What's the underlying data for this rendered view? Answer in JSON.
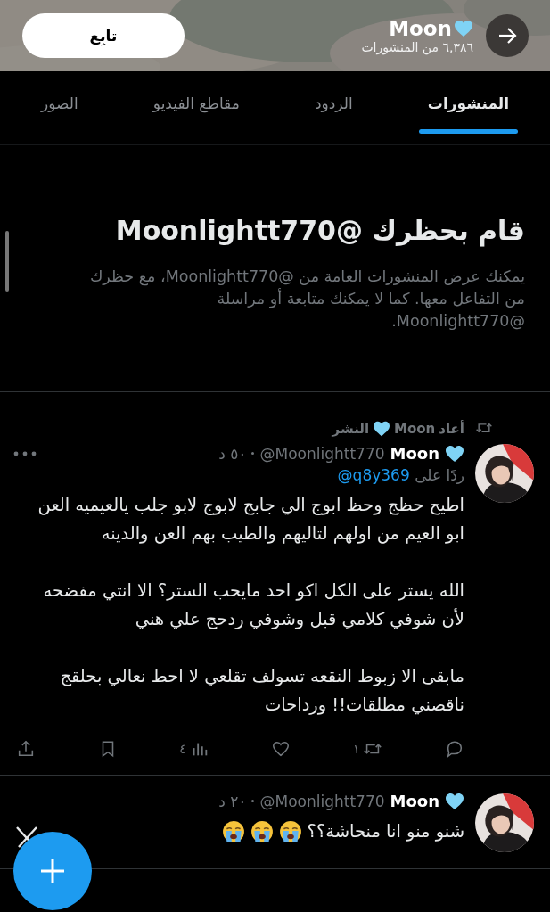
{
  "header": {
    "name": "Moon",
    "post_count": "٦,٣٨٦ من المنشورات",
    "follow_button": "تابِع"
  },
  "tabs": [
    {
      "label": "المنشورات",
      "selected": true
    },
    {
      "label": "الردود",
      "selected": false
    },
    {
      "label": "مقاطع الفيديو",
      "selected": false
    },
    {
      "label": "الصور",
      "selected": false
    }
  ],
  "blocked_notice": {
    "title": "قام بحظرك @Moonlightt770",
    "body": "يمكنك عرض المنشورات العامة من @Moonlightt770، مع حظرك من التفاعل معها. كما لا يمكنك متابعة أو مراسلة @Moonlightt770."
  },
  "posts": [
    {
      "repost_label": "أعاد",
      "repost_name": "Moon",
      "repost_suffix": "النشر",
      "name": "Moon",
      "handle": "@Moonlightt770",
      "time": "٥٠ د",
      "reply_prefix": "ردًا على",
      "reply_to": "@q8y369",
      "paragraphs": [
        "اطيح حظج وحظ ابوج الي جابج لابوج لابو جلب يالعيميه العن ابو العيم من اولهم لتاليهم والطيب بهم العن والدينه",
        "الله يستر على الكل اكو احد مايحب الستر؟ الا انتي مفضحه لأن شوفي كلامي قبل وشوفي ردحج علي هني",
        "مابقى الا زبوط النقعه تسولف تقلعي لا احط نعالي بحلقج ناقصني مطلقات!! ورداحات"
      ],
      "actions": [
        {
          "kind": "reply"
        },
        {
          "kind": "repost",
          "count": "١"
        },
        {
          "kind": "like"
        },
        {
          "kind": "views",
          "count": "٤"
        },
        {
          "kind": "bookmark"
        },
        {
          "kind": "share"
        }
      ]
    },
    {
      "name": "Moon",
      "handle": "@Moonlightt770",
      "time": "٢٠ د",
      "paragraphs": [
        "شنو منو انا منحاشة؟؟"
      ],
      "emojis": [
        {
          "kind": "crying"
        },
        {
          "kind": "crying"
        },
        {
          "kind": "crying"
        }
      ]
    }
  ]
}
